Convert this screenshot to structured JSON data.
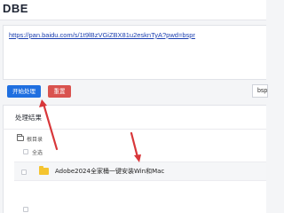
{
  "header": {
    "brand": "DBE"
  },
  "input": {
    "link": "https://pan.baidu.com/s/1t9lBzVGiZBX81u2esknTyA?pwd=bspr"
  },
  "actions": {
    "start_label": "开始处理",
    "reset_label": "重置"
  },
  "code_field": {
    "value": "bsp"
  },
  "results": {
    "title": "处理结果",
    "root_label": "根目录",
    "select_all_label": "全选",
    "items": [
      {
        "name": "Adobe2024全家桶一键安装Win和Mac",
        "type": "folder"
      }
    ]
  },
  "colors": {
    "primary": "#1f6fe0",
    "danger": "#d9534f",
    "annotation_arrow": "#d8373a",
    "folder": "#f4c430"
  },
  "icons": {
    "root": "folder-outline-icon",
    "item": "folder-icon"
  }
}
